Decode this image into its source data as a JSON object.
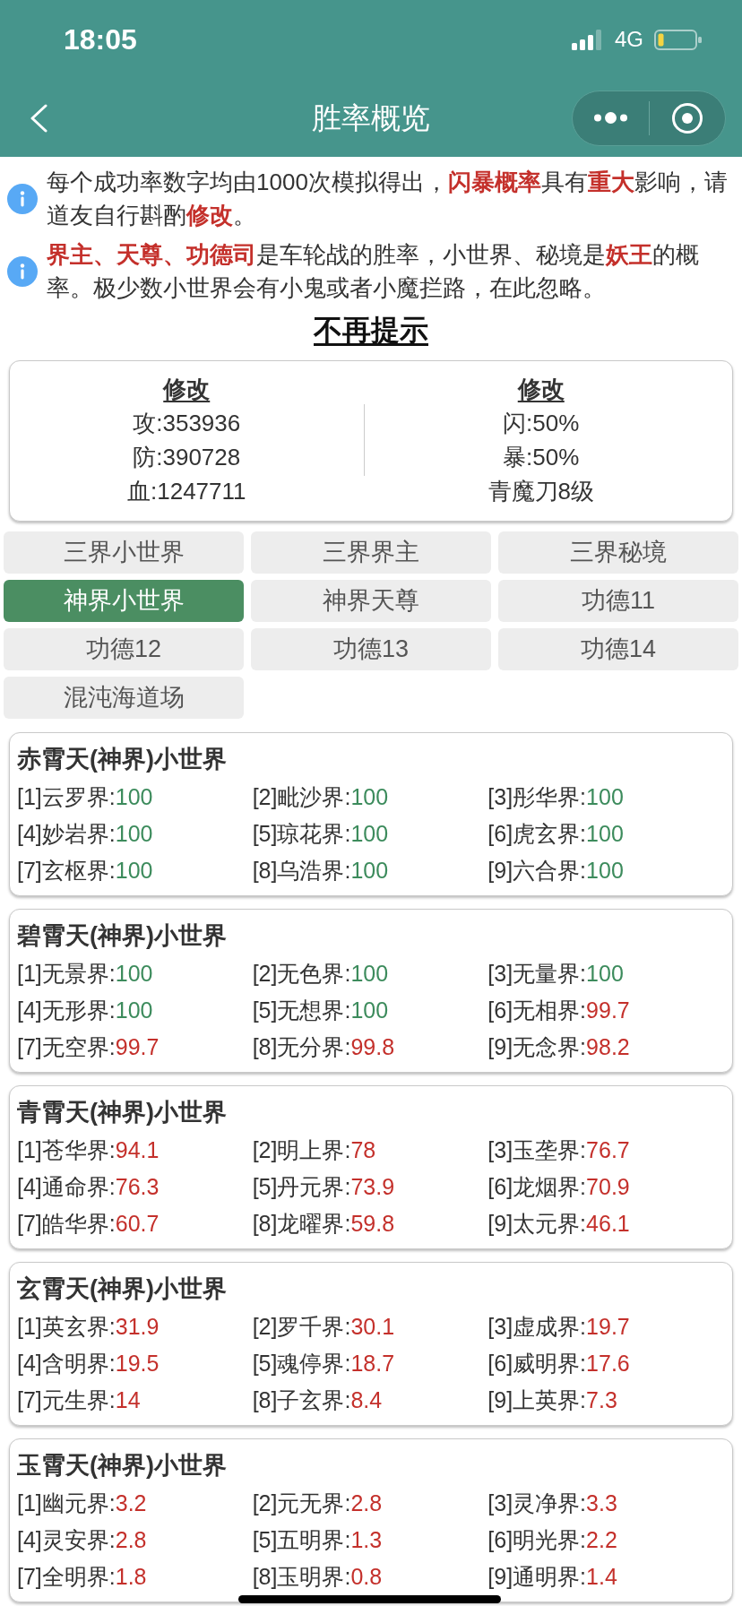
{
  "status_bar": {
    "time": "18:05",
    "network": "4G"
  },
  "nav_bar": {
    "title": "胜率概览"
  },
  "notices": [
    {
      "text": "每个成功率数字均由1000次模拟得出，**闪暴概率**具有**重大**影响，请道友自行斟酌**修改**。"
    },
    {
      "text": "**界主、天尊、功德司**是车轮战的胜率，小世界、秘境是**妖王**的概率。极少数小世界会有小鬼或者小魔拦路，在此忽略。"
    }
  ],
  "dismiss_link": "不再提示",
  "stats_card": {
    "columns": [
      {
        "edit_label": "修改",
        "lines": [
          "攻:353936",
          "防:390728",
          "血:1247711"
        ]
      },
      {
        "edit_label": "修改",
        "lines": [
          "闪:50%",
          "暴:50%",
          "青魔刀8级"
        ]
      }
    ]
  },
  "tabs": [
    {
      "label": "三界小世界",
      "selected": false
    },
    {
      "label": "三界界主",
      "selected": false
    },
    {
      "label": "三界秘境",
      "selected": false
    },
    {
      "label": "神界小世界",
      "selected": true
    },
    {
      "label": "神界天尊",
      "selected": false
    },
    {
      "label": "功德11",
      "selected": false
    },
    {
      "label": "功德12",
      "selected": false
    },
    {
      "label": "功德13",
      "selected": false
    },
    {
      "label": "功德14",
      "selected": false
    },
    {
      "label": "混沌海道场",
      "selected": false
    }
  ],
  "groups": [
    {
      "title": "赤霄天(神界)小世界",
      "items": [
        {
          "label": "[1]云罗界:",
          "value": "100",
          "color": "#3c8b5c"
        },
        {
          "label": "[2]毗沙界:",
          "value": "100",
          "color": "#3c8b5c"
        },
        {
          "label": "[3]彤华界:",
          "value": "100",
          "color": "#3c8b5c"
        },
        {
          "label": "[4]妙岩界:",
          "value": "100",
          "color": "#3c8b5c"
        },
        {
          "label": "[5]琼花界:",
          "value": "100",
          "color": "#3c8b5c"
        },
        {
          "label": "[6]虎玄界:",
          "value": "100",
          "color": "#3c8b5c"
        },
        {
          "label": "[7]玄枢界:",
          "value": "100",
          "color": "#3c8b5c"
        },
        {
          "label": "[8]乌浩界:",
          "value": "100",
          "color": "#3c8b5c"
        },
        {
          "label": "[9]六合界:",
          "value": "100",
          "color": "#3c8b5c"
        }
      ]
    },
    {
      "title": "碧霄天(神界)小世界",
      "items": [
        {
          "label": "[1]无景界:",
          "value": "100",
          "color": "#3c8b5c"
        },
        {
          "label": "[2]无色界:",
          "value": "100",
          "color": "#3c8b5c"
        },
        {
          "label": "[3]无量界:",
          "value": "100",
          "color": "#3c8b5c"
        },
        {
          "label": "[4]无形界:",
          "value": "100",
          "color": "#3c8b5c"
        },
        {
          "label": "[5]无想界:",
          "value": "100",
          "color": "#3c8b5c"
        },
        {
          "label": "[6]无相界:",
          "value": "99.7",
          "color": "#c4302b"
        },
        {
          "label": "[7]无空界:",
          "value": "99.7",
          "color": "#c4302b"
        },
        {
          "label": "[8]无分界:",
          "value": "99.8",
          "color": "#c4302b"
        },
        {
          "label": "[9]无念界:",
          "value": "98.2",
          "color": "#c4302b"
        }
      ]
    },
    {
      "title": "青霄天(神界)小世界",
      "items": [
        {
          "label": "[1]苍华界:",
          "value": "94.1",
          "color": "#c4302b"
        },
        {
          "label": "[2]明上界:",
          "value": "78",
          "color": "#c4302b"
        },
        {
          "label": "[3]玉垄界:",
          "value": "76.7",
          "color": "#c4302b"
        },
        {
          "label": "[4]通命界:",
          "value": "76.3",
          "color": "#c4302b"
        },
        {
          "label": "[5]丹元界:",
          "value": "73.9",
          "color": "#c4302b"
        },
        {
          "label": "[6]龙烟界:",
          "value": "70.9",
          "color": "#c4302b"
        },
        {
          "label": "[7]皓华界:",
          "value": "60.7",
          "color": "#c4302b"
        },
        {
          "label": "[8]龙曜界:",
          "value": "59.8",
          "color": "#c4302b"
        },
        {
          "label": "[9]太元界:",
          "value": "46.1",
          "color": "#c4302b"
        }
      ]
    },
    {
      "title": "玄霄天(神界)小世界",
      "items": [
        {
          "label": "[1]英玄界:",
          "value": "31.9",
          "color": "#c4302b"
        },
        {
          "label": "[2]罗千界:",
          "value": "30.1",
          "color": "#c4302b"
        },
        {
          "label": "[3]虚成界:",
          "value": "19.7",
          "color": "#c4302b"
        },
        {
          "label": "[4]含明界:",
          "value": "19.5",
          "color": "#c4302b"
        },
        {
          "label": "[5]魂停界:",
          "value": "18.7",
          "color": "#c4302b"
        },
        {
          "label": "[6]威明界:",
          "value": "17.6",
          "color": "#c4302b"
        },
        {
          "label": "[7]元生界:",
          "value": "14",
          "color": "#c4302b"
        },
        {
          "label": "[8]子玄界:",
          "value": "8.4",
          "color": "#c4302b"
        },
        {
          "label": "[9]上英界:",
          "value": "7.3",
          "color": "#c4302b"
        }
      ]
    },
    {
      "title": "玉霄天(神界)小世界",
      "items": [
        {
          "label": "[1]幽元界:",
          "value": "3.2",
          "color": "#c4302b"
        },
        {
          "label": "[2]元无界:",
          "value": "2.8",
          "color": "#c4302b"
        },
        {
          "label": "[3]灵净界:",
          "value": "3.3",
          "color": "#c4302b"
        },
        {
          "label": "[4]灵安界:",
          "value": "2.8",
          "color": "#c4302b"
        },
        {
          "label": "[5]五明界:",
          "value": "1.3",
          "color": "#c4302b"
        },
        {
          "label": "[6]明光界:",
          "value": "2.2",
          "color": "#c4302b"
        },
        {
          "label": "[7]全明界:",
          "value": "1.8",
          "color": "#c4302b"
        },
        {
          "label": "[8]玉明界:",
          "value": "0.8",
          "color": "#c4302b"
        },
        {
          "label": "[9]通明界:",
          "value": "1.4",
          "color": "#c4302b"
        }
      ]
    }
  ]
}
